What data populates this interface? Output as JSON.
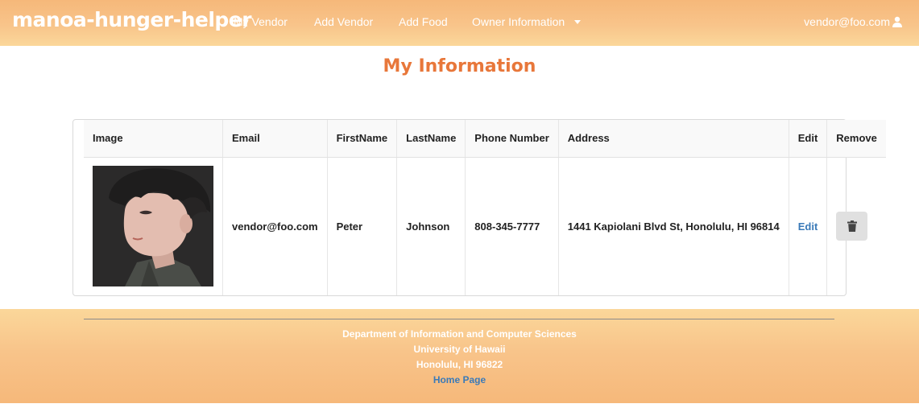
{
  "navbar": {
    "brand": "manoa-hunger-helper",
    "items": [
      {
        "label": "My Vendor"
      },
      {
        "label": "Add Vendor"
      },
      {
        "label": "Add Food"
      },
      {
        "label": "Owner Information"
      }
    ],
    "user_email": "vendor@foo.com",
    "user_icon": "user-icon",
    "dropdown_icon": "caret-down-icon"
  },
  "page": {
    "title": "My Information"
  },
  "table": {
    "columns": [
      "Image",
      "Email",
      "FirstName",
      "LastName",
      "Phone Number",
      "Address",
      "Edit",
      "Remove"
    ],
    "rows": [
      {
        "image": "vendor-photo",
        "email": "vendor@foo.com",
        "first_name": "Peter",
        "last_name": "Johnson",
        "phone": "808-345-7777",
        "address": "1441 Kapiolani Blvd St, Honolulu, HI 96814",
        "edit_label": "Edit",
        "remove_icon": "trash-icon"
      }
    ]
  },
  "footer": {
    "line1": "Department of Information and Computer Sciences",
    "line2": "University of Hawaii",
    "line3": "Honolulu, HI 96822",
    "link": "Home Page"
  },
  "colors": {
    "accent_title": "#e8773a",
    "link": "#3a7ab8",
    "nav_gradient_start": "#f6b87a",
    "nav_gradient_end": "#fbd79a"
  }
}
